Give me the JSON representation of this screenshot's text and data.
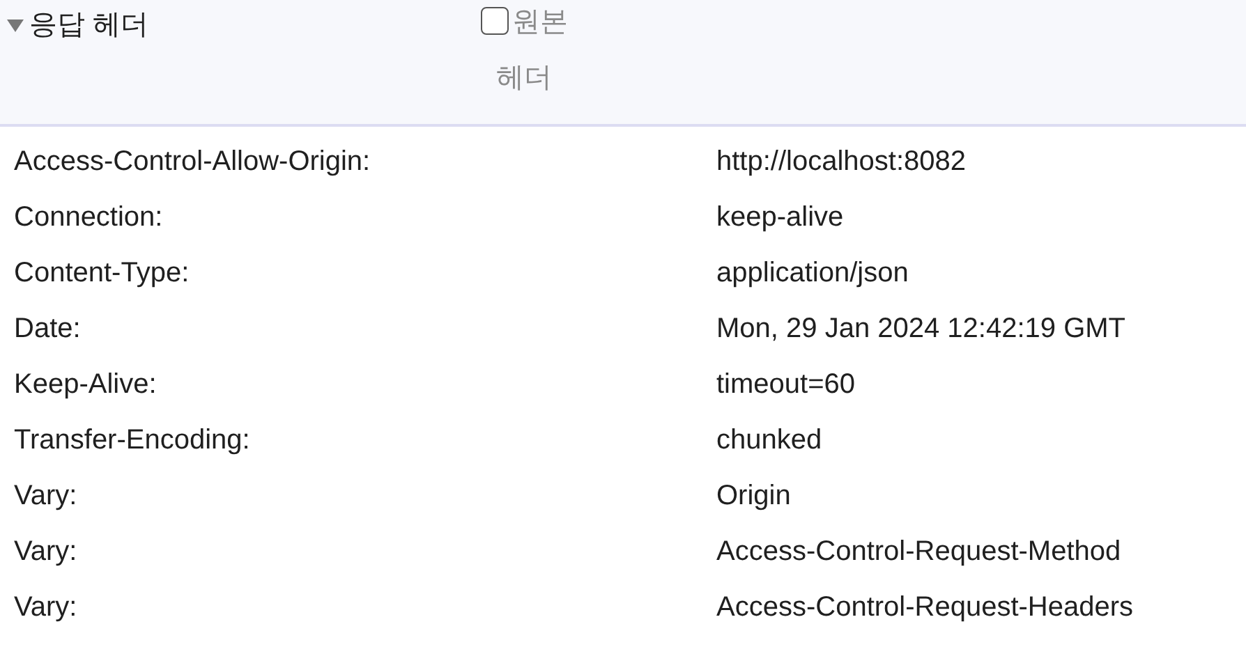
{
  "section": {
    "title": "응답 헤더",
    "expanded": true
  },
  "raw_toggle": {
    "label": "원본 헤더",
    "checked": false
  },
  "headers": [
    {
      "name": "Access-Control-Allow-Origin:",
      "value": "http://localhost:8082"
    },
    {
      "name": "Connection:",
      "value": "keep-alive"
    },
    {
      "name": "Content-Type:",
      "value": "application/json"
    },
    {
      "name": "Date:",
      "value": "Mon, 29 Jan 2024 12:42:19 GMT"
    },
    {
      "name": "Keep-Alive:",
      "value": "timeout=60"
    },
    {
      "name": "Transfer-Encoding:",
      "value": "chunked"
    },
    {
      "name": "Vary:",
      "value": "Origin"
    },
    {
      "name": "Vary:",
      "value": "Access-Control-Request-Method"
    },
    {
      "name": "Vary:",
      "value": "Access-Control-Request-Headers"
    }
  ]
}
